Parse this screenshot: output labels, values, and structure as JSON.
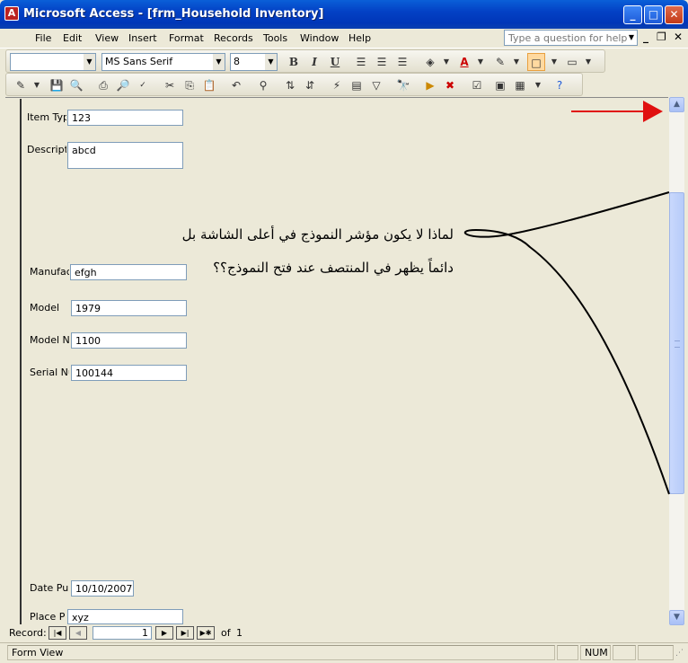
{
  "window": {
    "title": "Microsoft Access - [frm_Household Inventory]"
  },
  "menu": [
    "File",
    "Edit",
    "View",
    "Insert",
    "Format",
    "Records",
    "Tools",
    "Window",
    "Help"
  ],
  "help_box": {
    "placeholder": "Type a question for help"
  },
  "format_toolbar": {
    "object_combo": "",
    "font_name": "MS Sans Serif",
    "font_size": "8"
  },
  "form": {
    "fields": [
      {
        "label": "Item Typ",
        "value": "123"
      },
      {
        "label": "Descripti",
        "value": "abcd"
      },
      {
        "label": "Manufac",
        "value": "efgh"
      },
      {
        "label": "Model",
        "value": "1979"
      },
      {
        "label": "Model N",
        "value": "1100"
      },
      {
        "label": "Serial Nu",
        "value": "100144"
      },
      {
        "label": "Date Pur",
        "value": "10/10/2007"
      },
      {
        "label": "Place Pu",
        "value": "xyz"
      }
    ]
  },
  "annotation": {
    "line1": "لماذا لا يكون مؤشر النموذج في أعلى الشاشة بل",
    "line2": "دائماً يظهر في المنتصف عند فتح النموذج؟؟",
    "arrow_color": "#e01010"
  },
  "navigation": {
    "label": "Record:",
    "current": "1",
    "of_label": "of",
    "total": "1"
  },
  "status": {
    "view": "Form View",
    "num": "NUM"
  },
  "colors": {
    "title_bar": "#0341c5",
    "window_bg": "#ece9d8"
  }
}
